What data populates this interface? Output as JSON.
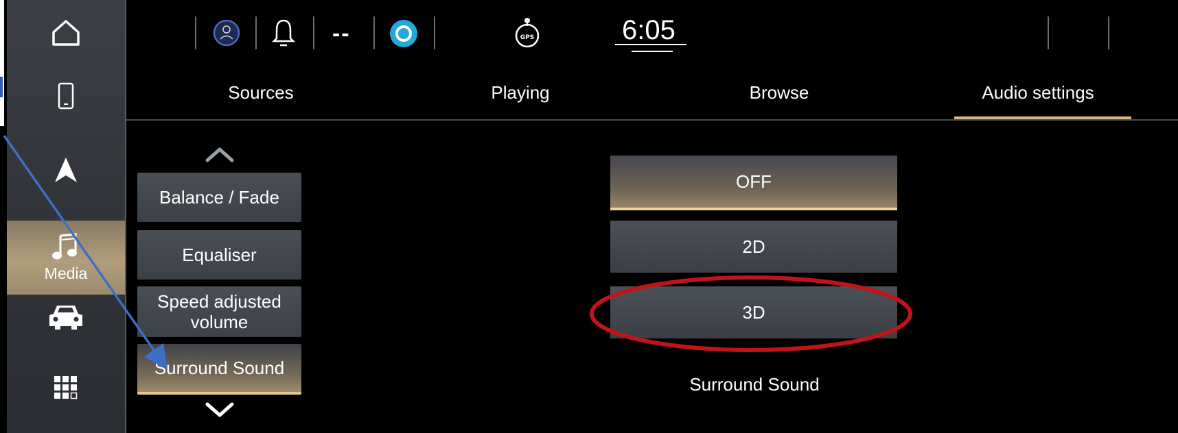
{
  "sidebar": {
    "items": [
      {
        "icon": "home-icon"
      },
      {
        "icon": "phone-icon"
      },
      {
        "icon": "navigation-icon"
      },
      {
        "icon": "music-note-icon",
        "label": "Media"
      },
      {
        "icon": "car-icon"
      },
      {
        "icon": "apps-grid-icon"
      }
    ]
  },
  "status_bar": {
    "signal_text": "--",
    "time": "6:05",
    "icons": [
      "driver-profile-icon",
      "bell-icon",
      "alexa-icon",
      "gps-icon"
    ]
  },
  "tabs": [
    {
      "label": "Sources"
    },
    {
      "label": "Playing"
    },
    {
      "label": "Browse"
    },
    {
      "label": "Audio settings"
    }
  ],
  "active_tab": "Audio settings",
  "menu": {
    "items": [
      {
        "label": "Balance / Fade"
      },
      {
        "label": "Equaliser"
      },
      {
        "label": "Speed adjusted volume"
      },
      {
        "label": "Surround Sound"
      }
    ],
    "active": "Surround Sound"
  },
  "options": {
    "items": [
      {
        "label": "OFF"
      },
      {
        "label": "2D"
      },
      {
        "label": "3D"
      }
    ],
    "selected": "OFF",
    "highlighted": "3D",
    "caption": "Surround Sound"
  },
  "colors": {
    "accent": "#d9b884",
    "annotation_circle": "#c0141a",
    "annotation_arrow": "#3f6fc4"
  }
}
